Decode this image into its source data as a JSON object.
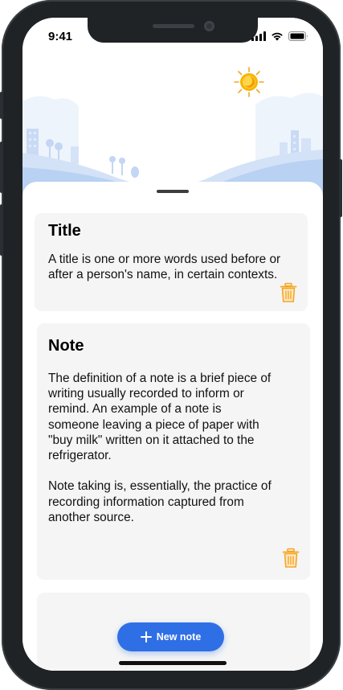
{
  "status_bar": {
    "time": "9:41",
    "icons": [
      "signal-icon",
      "wifi-icon",
      "battery-icon"
    ]
  },
  "header": {
    "illustration": "city-skyline-icon",
    "theme_toggle_icon": "sun-icon"
  },
  "notes": [
    {
      "title": "Title",
      "body": "A title is one or more words used before or after a person's name, in certain contexts.",
      "delete_icon": "trash-icon"
    },
    {
      "title": "Note",
      "body": "The definition of a note is a brief piece of writing usually recorded to inform or remind. An example of a note is someone leaving a piece of paper with \"buy milk\" written on it attached to the refrigerator.\n\nNote taking is, essentially, the practice of recording information captured from another source.",
      "delete_icon": "trash-icon"
    },
    {
      "title": "",
      "body": ""
    }
  ],
  "fab": {
    "label": "New note",
    "icon": "plus-icon"
  },
  "colors": {
    "accent": "#2F6FE5",
    "card_background": "#F5F5F5",
    "trash": "#F5A623",
    "sun": "#F7B500"
  }
}
